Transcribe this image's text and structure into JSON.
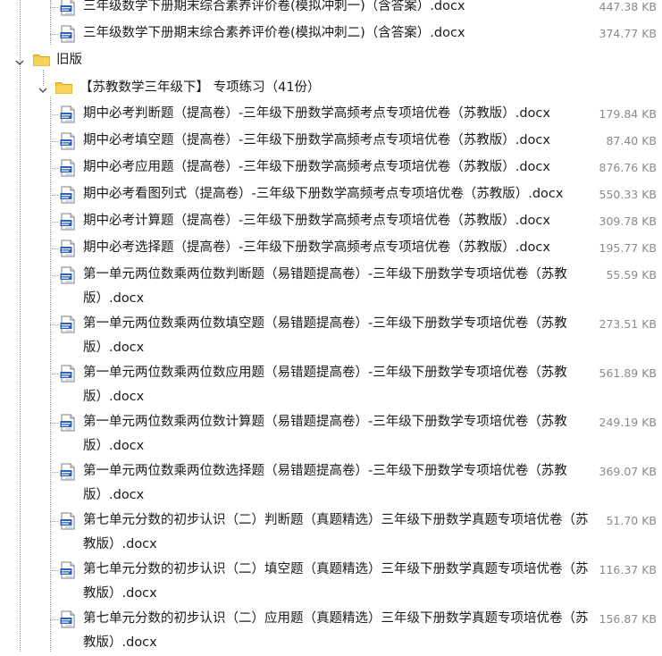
{
  "tree": {
    "top_files": [
      {
        "name": "三年级数学下册期末综合素养评价卷(模拟冲刺一)（含答案）.docx",
        "size": "447.38 KB"
      },
      {
        "name": "三年级数学下册期末综合素养评价卷(模拟冲刺二)（含答案）.docx",
        "size": "374.77 KB"
      }
    ],
    "folder_old": {
      "label": "旧版"
    },
    "subfolder": {
      "label": "【苏教数学三年级下】 专项练习（41份）"
    },
    "files": [
      {
        "name": "期中必考判断题（提高卷）-三年级下册数学高频考点专项培优卷（苏教版）.docx",
        "size": "179.84 KB"
      },
      {
        "name": "期中必考填空题（提高卷）-三年级下册数学高频考点专项培优卷（苏教版）.docx",
        "size": "87.40 KB"
      },
      {
        "name": "期中必考应用题（提高卷）-三年级下册数学高频考点专项培优卷（苏教版）.docx",
        "size": "876.76 KB"
      },
      {
        "name": "期中必考看图列式（提高卷）-三年级下册数学高频考点专项培优卷（苏教版）.docx",
        "size": "550.33 KB"
      },
      {
        "name": "期中必考计算题（提高卷）-三年级下册数学高频考点专项培优卷（苏教版）.docx",
        "size": "309.78 KB"
      },
      {
        "name": "期中必考选择题（提高卷）-三年级下册数学高频考点专项培优卷（苏教版）.docx",
        "size": "195.77 KB"
      },
      {
        "name": "第一单元两位数乘两位数判断题（易错题提高卷）-三年级下册数学专项培优卷（苏教版）.docx",
        "size": "55.59 KB"
      },
      {
        "name": "第一单元两位数乘两位数填空题（易错题提高卷）-三年级下册数学专项培优卷（苏教版）.docx",
        "size": "273.51 KB"
      },
      {
        "name": "第一单元两位数乘两位数应用题（易错题提高卷）-三年级下册数学专项培优卷（苏教版）.docx",
        "size": "561.89 KB"
      },
      {
        "name": "第一单元两位数乘两位数计算题（易错题提高卷）-三年级下册数学专项培优卷（苏教版）.docx",
        "size": "249.19 KB"
      },
      {
        "name": "第一单元两位数乘两位数选择题（易错题提高卷）-三年级下册数学专项培优卷（苏教版）.docx",
        "size": "369.07 KB"
      },
      {
        "name": "第七单元分数的初步认识（二）判断题（真题精选）三年级下册数学真题专项培优卷（苏教版）.docx",
        "size": "51.70 KB"
      },
      {
        "name": "第七单元分数的初步认识（二）填空题（真题精选）三年级下册数学真题专项培优卷（苏教版）.docx",
        "size": "116.37 KB"
      },
      {
        "name": "第七单元分数的初步认识（二）应用题（真题精选）三年级下册数学真题专项培优卷（苏教版）.docx",
        "size": "156.87 KB"
      }
    ]
  },
  "colors": {
    "folder": "#f5c542",
    "doc_blue": "#2b5fb8",
    "size_text": "#8a8a8a",
    "guide": "#9a9a9a"
  }
}
